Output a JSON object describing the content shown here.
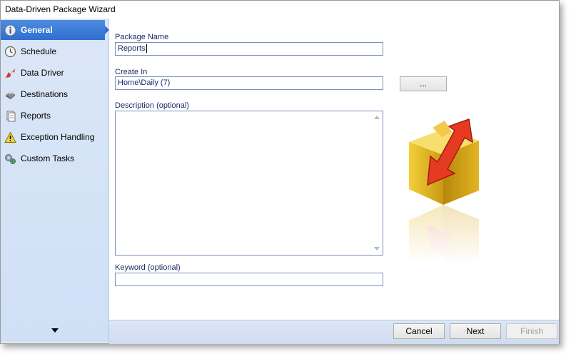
{
  "window": {
    "title": "Data-Driven Package Wizard"
  },
  "sidebar": {
    "items": [
      {
        "label": "General",
        "icon": "info-icon",
        "active": true
      },
      {
        "label": "Schedule",
        "icon": "clock-icon",
        "active": false
      },
      {
        "label": "Data Driver",
        "icon": "data-driver-icon",
        "active": false
      },
      {
        "label": "Destinations",
        "icon": "printer-icon",
        "active": false
      },
      {
        "label": "Reports",
        "icon": "document-icon",
        "active": false
      },
      {
        "label": "Exception Handling",
        "icon": "warning-icon",
        "active": false
      },
      {
        "label": "Custom Tasks",
        "icon": "gears-icon",
        "active": false
      }
    ],
    "more_icon": "chevron-down-icon"
  },
  "form": {
    "package_name_label": "Package Name",
    "package_name_value": "Reports",
    "create_in_label": "Create In",
    "create_in_value": "Home\\Daily (7)",
    "browse_label": "...",
    "description_label": "Description (optional)",
    "description_value": "",
    "keyword_label": "Keyword (optional)",
    "keyword_value": "",
    "illustration_icon": "package-box-icon"
  },
  "footer": {
    "cancel_label": "Cancel",
    "next_label": "Next",
    "finish_label": "Finish"
  },
  "colors": {
    "active_nav": "#2e6fd0",
    "sidebar_bg": "#d5e3f6",
    "label_text": "#1c2a66"
  }
}
